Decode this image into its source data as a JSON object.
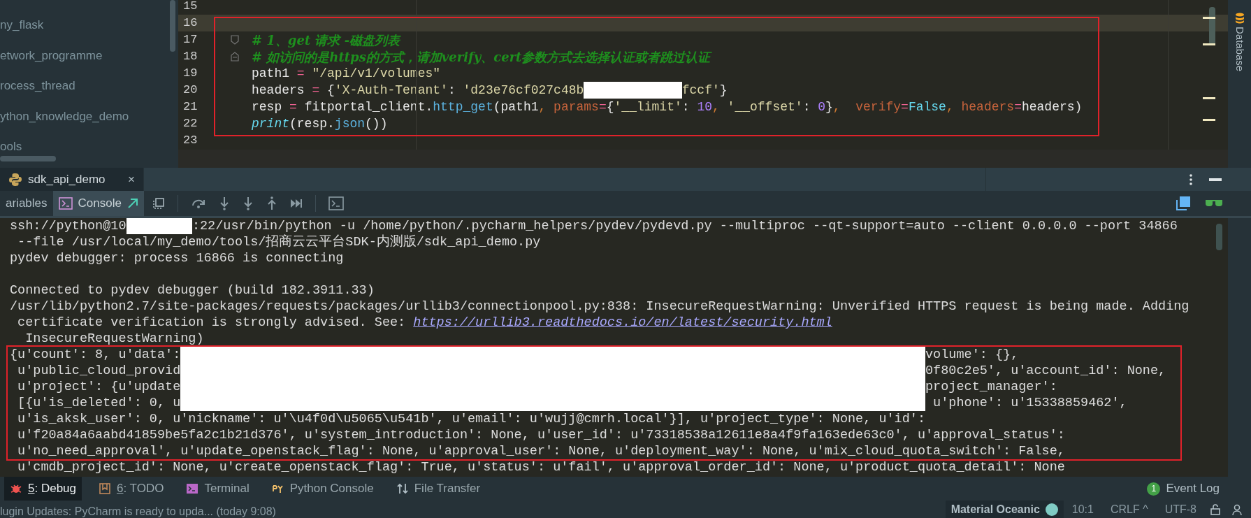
{
  "project_tree": {
    "items": [
      {
        "label": "ny_flask"
      },
      {
        "label": "etwork_programme"
      },
      {
        "label": "rocess_thread"
      },
      {
        "label": "ython_knowledge_demo"
      },
      {
        "label": "ools"
      }
    ]
  },
  "editor": {
    "lines": [
      {
        "number": "15",
        "current": false
      },
      {
        "number": "16",
        "current": true
      },
      {
        "number": "17",
        "current": false,
        "fold_start": true,
        "tokens": [
          {
            "kind": "comment",
            "text": "# 1、get 请求 -磁盘列表"
          }
        ]
      },
      {
        "number": "18",
        "current": false,
        "fold_end": true,
        "tokens": [
          {
            "kind": "comment",
            "text": "# 如访问的是https的方式，请加verify、cert参数方式去选择认证或者跳过认证"
          }
        ]
      },
      {
        "number": "19",
        "current": false,
        "tokens": [
          {
            "kind": "plain",
            "text": "path1 "
          },
          {
            "kind": "op",
            "text": "="
          },
          {
            "kind": "string",
            "text": " \"/api/v1/volumes\""
          }
        ]
      },
      {
        "number": "20",
        "current": false,
        "tokens": [
          {
            "kind": "plain",
            "text": "headers "
          },
          {
            "kind": "op",
            "text": "="
          },
          {
            "kind": "plain",
            "text": " {"
          },
          {
            "kind": "string",
            "text": "'X-Auth-Tenant'"
          },
          {
            "kind": "plain",
            "text": ": "
          },
          {
            "kind": "string",
            "text": "'d23e76cf027c48b"
          },
          {
            "kind": "redacted"
          },
          {
            "kind": "string",
            "text": "fccf'"
          },
          {
            "kind": "plain",
            "text": "}"
          }
        ]
      },
      {
        "number": "21",
        "current": false,
        "tokens": [
          {
            "kind": "plain",
            "text": "resp "
          },
          {
            "kind": "op",
            "text": "="
          },
          {
            "kind": "plain",
            "text": " fitportal_client."
          },
          {
            "kind": "call",
            "text": "http_get"
          },
          {
            "kind": "plain",
            "text": "(path1"
          },
          {
            "kind": "punct",
            "text": ", "
          },
          {
            "kind": "kwarg",
            "text": "params"
          },
          {
            "kind": "op",
            "text": "="
          },
          {
            "kind": "plain",
            "text": "{"
          },
          {
            "kind": "string",
            "text": "'__limit'"
          },
          {
            "kind": "plain",
            "text": ": "
          },
          {
            "kind": "number",
            "text": "10"
          },
          {
            "kind": "punct",
            "text": ", "
          },
          {
            "kind": "string",
            "text": "'__offset'"
          },
          {
            "kind": "plain",
            "text": ": "
          },
          {
            "kind": "number",
            "text": "0"
          },
          {
            "kind": "plain",
            "text": "}"
          },
          {
            "kind": "punct",
            "text": ",  "
          },
          {
            "kind": "kwarg",
            "text": "verify"
          },
          {
            "kind": "op",
            "text": "="
          },
          {
            "kind": "constant",
            "text": "False"
          },
          {
            "kind": "punct",
            "text": ", "
          },
          {
            "kind": "kwarg",
            "text": "headers"
          },
          {
            "kind": "op",
            "text": "="
          },
          {
            "kind": "plain",
            "text": "headers)"
          }
        ]
      },
      {
        "number": "22",
        "current": false,
        "tokens": [
          {
            "kind": "builtin",
            "text": "print"
          },
          {
            "kind": "plain",
            "text": "(resp."
          },
          {
            "kind": "call",
            "text": "json"
          },
          {
            "kind": "plain",
            "text": "())"
          }
        ]
      },
      {
        "number": "23",
        "current": false
      }
    ]
  },
  "side_panel": {
    "label": "Database"
  },
  "run_tab": {
    "label": "sdk_api_demo",
    "close": "×"
  },
  "debug_tabs": [
    {
      "label": "ariables",
      "selected": false
    },
    {
      "label": "Console",
      "selected": true
    }
  ],
  "console": {
    "lines": [
      {
        "kind": "output",
        "segments": [
          {
            "kind": "text",
            "text": "ssh://python@10"
          },
          {
            "kind": "redacted"
          },
          {
            "kind": "text",
            "text": ":22/usr/bin/python -u /home/python/.pycharm_helpers/pydev/pydevd.py --multiproc --qt-support=auto --client 0.0.0.0 --port 34866"
          }
        ]
      },
      {
        "kind": "output",
        "segments": [
          {
            "kind": "text",
            "text": " --file /usr/local/my_demo/tools/招商云云平台SDK-内测版/sdk_api_demo.py"
          }
        ]
      },
      {
        "kind": "output",
        "segments": [
          {
            "kind": "text",
            "text": "pydev debugger: process 16866 is connecting"
          }
        ]
      },
      {
        "kind": "blank"
      },
      {
        "kind": "output",
        "segments": [
          {
            "kind": "text",
            "text": "Connected to pydev debugger (build 182.3911.33)"
          }
        ]
      },
      {
        "kind": "output",
        "segments": [
          {
            "kind": "text",
            "text": "/usr/lib/python2.7/site-packages/requests/packages/urllib3/connectionpool.py:838: InsecureRequestWarning: Unverified HTTPS request is being made. Adding"
          }
        ]
      },
      {
        "kind": "output",
        "segments": [
          {
            "kind": "text",
            "text": " certificate verification is strongly advised. See: "
          },
          {
            "kind": "link",
            "text": "https://urllib3.readthedocs.io/en/latest/security.html"
          }
        ]
      },
      {
        "kind": "output",
        "segments": [
          {
            "kind": "text",
            "text": "  InsecureRequestWarning)"
          }
        ]
      },
      {
        "kind": "output",
        "segments": [
          {
            "kind": "text",
            "text": "{u'count': 8, u'data':"
          },
          {
            "kind": "redacted"
          },
          {
            "kind": "text",
            "text": "volume': {},"
          }
        ]
      },
      {
        "kind": "output",
        "segments": [
          {
            "kind": "text",
            "text": " u'public_cloud_provid"
          },
          {
            "kind": "redacted"
          },
          {
            "kind": "text",
            "text": "0f80c2e5', u'account_id': None,"
          }
        ]
      },
      {
        "kind": "output",
        "segments": [
          {
            "kind": "text",
            "text": " u'project': {u'update"
          },
          {
            "kind": "redacted"
          },
          {
            "kind": "text",
            "text": "project_manager':"
          }
        ]
      },
      {
        "kind": "output",
        "segments": [
          {
            "kind": "text",
            "text": " [{u'is_deleted': 0, u"
          },
          {
            "kind": "redacted"
          },
          {
            "kind": "text",
            "text": " u'phone': u'15338859462',"
          }
        ]
      },
      {
        "kind": "output",
        "segments": [
          {
            "kind": "text",
            "text": " u'is_aksk_user': 0, u'nickname': u'\\u4f0d\\u5065\\u541b', u'email': u'wujj@cmrh.local'}], u'project_type': None, u'id':"
          }
        ]
      },
      {
        "kind": "output",
        "segments": [
          {
            "kind": "text",
            "text": " u'f20a84a6aabd41859be5fa2c1b21d376', u'system_introduction': None, u'user_id': u'73318538a12611e8a4f9fa163ede63c0', u'approval_status':"
          }
        ]
      },
      {
        "kind": "output",
        "segments": [
          {
            "kind": "text",
            "text": " u'no_need_approval', u'update_openstack_flag': None, u'approval_user': None, u'deployment_way': None, u'mix_cloud_quota_switch': False,"
          }
        ]
      },
      {
        "kind": "output",
        "segments": [
          {
            "kind": "text",
            "text": " u'cmdb_project_id': None, u'create_openstack_flag': True, u'status': u'fail', u'approval_order_id': None, u'product_quota_detail': None"
          }
        ]
      }
    ]
  },
  "tool_windows": [
    {
      "kind": "debug",
      "mnemonic": "5",
      "label": ": Debug",
      "selected": true
    },
    {
      "kind": "todo",
      "mnemonic": "6",
      "label": ": TODO",
      "selected": false
    },
    {
      "kind": "terminal",
      "label": "Terminal",
      "selected": false
    },
    {
      "kind": "python",
      "label": "Python Console",
      "selected": false
    },
    {
      "kind": "transfer",
      "label": "File Transfer",
      "selected": false
    }
  ],
  "event_log": {
    "count": "1",
    "label": "Event Log"
  },
  "status_bar": {
    "message": "lugin Updates: PyCharm is ready to upda... (today 9:08)",
    "theme": "Material Oceanic",
    "position": "10:1",
    "line_separator": "CRLF ^",
    "encoding": "UTF-8"
  }
}
